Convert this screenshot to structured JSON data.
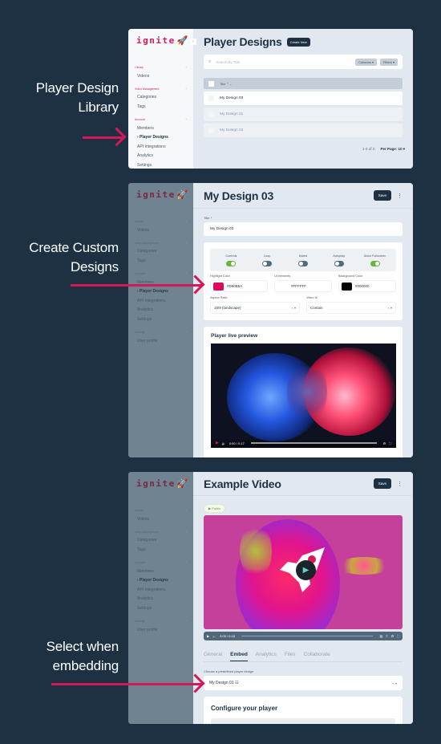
{
  "captions": [
    {
      "line1": "Player Design",
      "line2": "Library"
    },
    {
      "line1": "Create Custom",
      "line2": "Designs"
    },
    {
      "line1": "Select when",
      "line2": "embedding"
    }
  ],
  "colors": {
    "background": "#1d3143",
    "accent": "#d6185a",
    "toggle_on": "#6bb33a"
  },
  "brand": {
    "name": "ignite",
    "icon": "rocket-icon"
  },
  "sidebar": {
    "groups": [
      {
        "label": "Library",
        "items": [
          {
            "label": "Videos"
          }
        ]
      },
      {
        "label": "Video Management",
        "items": [
          {
            "label": "Categories"
          },
          {
            "label": "Tags"
          }
        ]
      },
      {
        "label": "Account",
        "items": [
          {
            "label": "Members"
          },
          {
            "label": "› Player Designs"
          },
          {
            "label": "API Integrations"
          },
          {
            "label": "Analytics"
          },
          {
            "label": "Settings"
          }
        ]
      },
      {
        "label": "Settings",
        "items": [
          {
            "label": "User profile"
          }
        ]
      }
    ]
  },
  "screen1": {
    "title": "Player Designs",
    "create_button": "Create New",
    "search_placeholder": "Search by Title",
    "columns_button": "Columns ▾",
    "filters_button": "Filters ▾",
    "table_header": "Title  ⌃⌄",
    "rows": [
      "My Design 03",
      "My Design 01",
      "My Design 02"
    ],
    "pager_range": "1-3 of 3",
    "per_page": "Per Page: 10 ▾"
  },
  "screen2": {
    "title": "My Design 03",
    "save_button": "Save",
    "title_label": "Title *",
    "title_value": "My Design 03",
    "toggles": [
      {
        "label": "Controls",
        "on": true
      },
      {
        "label": "Loop",
        "on": false
      },
      {
        "label": "Muted",
        "on": false
      },
      {
        "label": "Autoplay",
        "on": false
      },
      {
        "label": "Allow Fullscreen",
        "on": true
      }
    ],
    "highlight_color_label": "Highlight Color",
    "highlight_color": "#D90B5A",
    "ui_elements_label": "UI elements",
    "ui_elements_color": "#FFFFFF",
    "background_color_label": "Background Color",
    "background_color": "#000000",
    "aspect_ratio_label": "Aspect Ratio",
    "aspect_ratio_value": "16/9 (landscape)",
    "video_fit_label": "Video fit",
    "video_fit_value": "Contain",
    "preview_title": "Player live preview",
    "player_time": "0:00 / 0:17"
  },
  "screen3": {
    "title": "Example Video",
    "save_button": "Save",
    "status_badge": "▶ Public",
    "player_time": "0:00 / 0:18",
    "tabs": [
      "General",
      "Embed",
      "Analytics",
      "Files",
      "Collaborate"
    ],
    "active_tab": "Embed",
    "design_label": "Choose a predefined player design",
    "design_value": "My Design 01  ☷",
    "config_title": "Configure your player"
  }
}
